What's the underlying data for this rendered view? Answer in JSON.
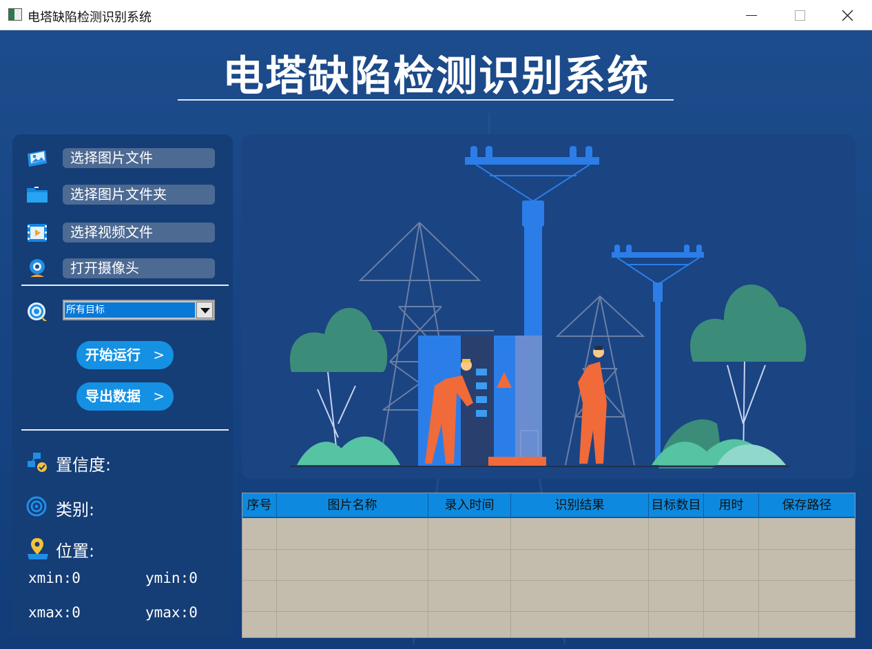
{
  "window": {
    "title": "电塔缺陷检测识别系统"
  },
  "header": {
    "title": "电塔缺陷检测识别系统"
  },
  "sidebar": {
    "menu": [
      {
        "label": "选择图片文件",
        "icon": "image-file-icon"
      },
      {
        "label": "选择图片文件夹",
        "icon": "folder-icon"
      },
      {
        "label": "选择视频文件",
        "icon": "video-file-icon"
      },
      {
        "label": "打开摄像头",
        "icon": "camera-icon"
      }
    ],
    "target_select": {
      "value": "所有目标",
      "icon": "target-icon"
    },
    "actions": {
      "start": "开始运行",
      "export": "导出数据",
      "chevron": ">"
    },
    "info": {
      "confidence_label": "置信度:",
      "class_label": "类别:",
      "position_label": "位置:"
    },
    "coords": {
      "xmin": "xmin:0",
      "ymin": "ymin:0",
      "xmax": "xmax:0",
      "ymax": "ymax:0"
    }
  },
  "table": {
    "columns": [
      "序号",
      "图片名称",
      "录入时间",
      "识别结果",
      "目标数目",
      "用时",
      "保存路径"
    ],
    "rows": []
  },
  "colors": {
    "background": "#174584",
    "panel": "#153d76",
    "menu_button": "#4d6a93",
    "action_button": "#1591e4",
    "table_header": "#0d8ae0",
    "table_body": "#c4bdad"
  }
}
